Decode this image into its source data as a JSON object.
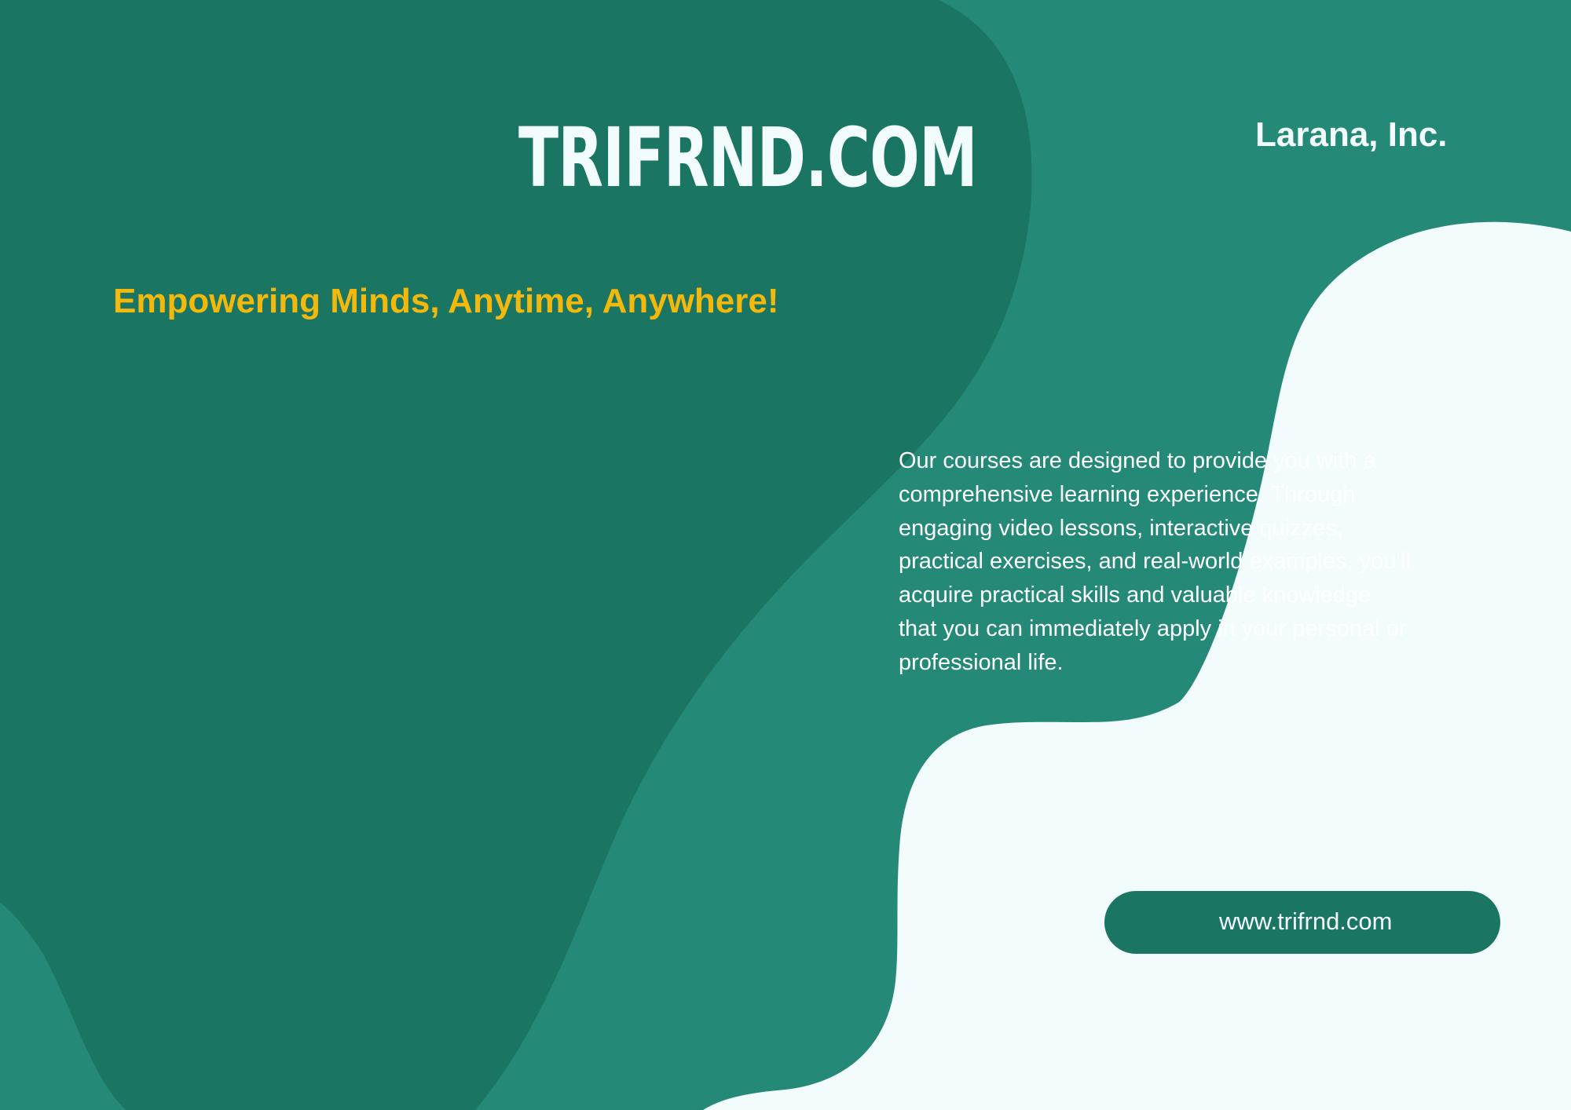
{
  "header": {
    "brand": "TRIFRND.COM",
    "company": "Larana, Inc."
  },
  "tagline": "Empowering Minds, Anytime, Anywhere!",
  "description": "Our courses are designed to provide you with a\ncomprehensive learning experience. Through\nengaging video lessons, interactive quizzes,\npractical exercises, and real-world examples, you'll\nacquire practical skills and valuable knowledge\nthat you can immediately apply in your personal or\nprofessional life.",
  "website": {
    "label": "www.trifrnd.com"
  },
  "colors": {
    "background": "#248977",
    "dark_blob": "#1b7563",
    "light_shape": "#f2fcfc",
    "accent": "#f2b90c",
    "text_light": "#ffffff"
  }
}
